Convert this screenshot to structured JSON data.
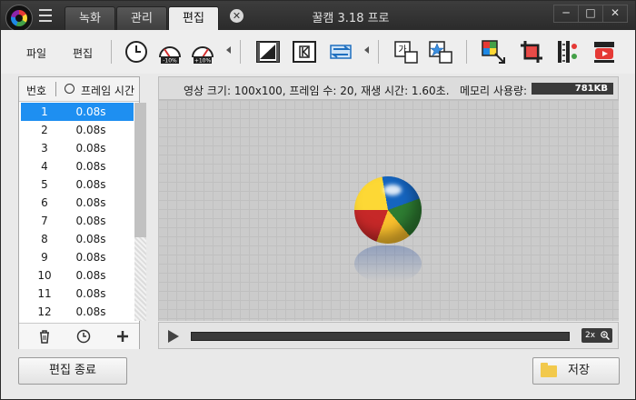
{
  "titlebar": {
    "tabs": [
      {
        "label": "녹화"
      },
      {
        "label": "관리"
      },
      {
        "label": "편집"
      }
    ],
    "close_tab_glyph": "✕",
    "title": "꿀캠 3.18 프로",
    "window_buttons": [
      "─",
      "□",
      "✕"
    ]
  },
  "toolbar": {
    "menu": [
      {
        "label": "파일"
      },
      {
        "label": "편집"
      }
    ],
    "icons": [
      "clock-icon",
      "speed-minus-10-icon",
      "speed-plus-10-icon",
      "frame-effect-icon",
      "frame-skip-icon",
      "frame-swap-icon",
      "text-insert-icon",
      "sticker-icon",
      "resize-icon",
      "crop-icon",
      "filter-icon",
      "youtube-icon"
    ],
    "speed_minus_label": "-10%",
    "speed_plus_label": "+10%",
    "text_icon_label": "가"
  },
  "frames": {
    "header_number": "번호",
    "header_time": "프레임 시간",
    "rows": [
      {
        "n": "1",
        "d": "0.08s",
        "selected": true
      },
      {
        "n": "2",
        "d": "0.08s"
      },
      {
        "n": "3",
        "d": "0.08s"
      },
      {
        "n": "4",
        "d": "0.08s"
      },
      {
        "n": "5",
        "d": "0.08s"
      },
      {
        "n": "6",
        "d": "0.08s"
      },
      {
        "n": "7",
        "d": "0.08s"
      },
      {
        "n": "8",
        "d": "0.08s"
      },
      {
        "n": "9",
        "d": "0.08s"
      },
      {
        "n": "10",
        "d": "0.08s"
      },
      {
        "n": "11",
        "d": "0.08s"
      },
      {
        "n": "12",
        "d": "0.08s"
      }
    ]
  },
  "info": {
    "text": "영상 크기: 100x100, 프레임 수: 20, 재생 시간: 1.60초.",
    "memory_label": "메모리 사용량:",
    "memory_value": "781KB"
  },
  "player": {
    "speed_label": "2x"
  },
  "buttons": {
    "end_edit": "편집 종료",
    "save": "저장"
  },
  "colors": {
    "selection": "#1e8ff1",
    "titlebar": "#333333"
  }
}
